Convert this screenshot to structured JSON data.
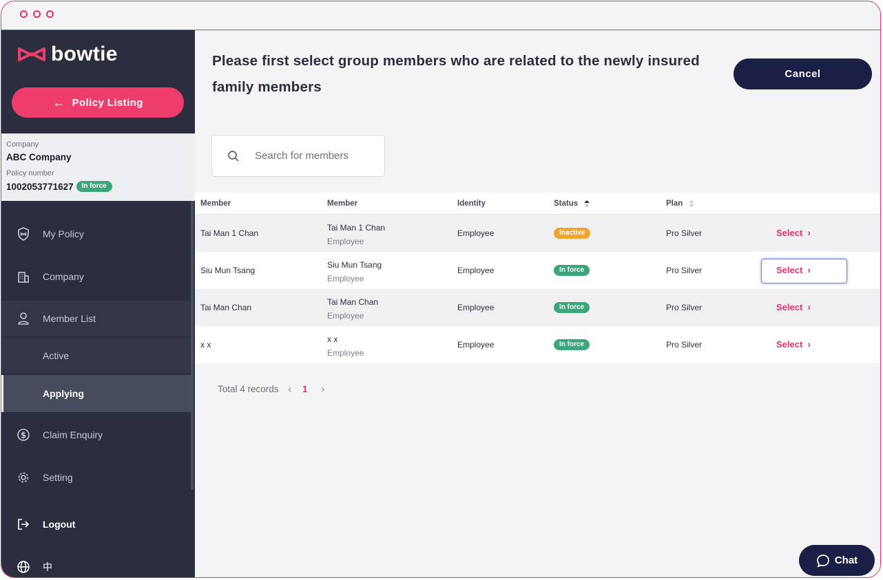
{
  "sidebar": {
    "logo": "bowtie",
    "policy_listing_label": "Policy Listing",
    "company_label": "Company",
    "company_value": "ABC Company",
    "policy_number_label": "Policy number",
    "policy_number_value": "1002053771627",
    "policy_status": "In force",
    "nav": {
      "my_policy": "My Policy",
      "company": "Company",
      "member_list": "Member List",
      "active": "Active",
      "applying": "Applying",
      "claim_enquiry": "Claim Enquiry",
      "setting": "Setting",
      "logout": "Logout",
      "language": "中"
    }
  },
  "main": {
    "heading": "Please first select group members who are related to the newly insured family members",
    "cancel_label": "Cancel",
    "search_placeholder": "Search for members",
    "columns": [
      "Member",
      "Member",
      "Identity",
      "Status",
      "Plan"
    ],
    "rows": [
      {
        "member": "Tai Man 1 Chan",
        "member_name": "Tai Man 1 Chan",
        "member_role": "Employee",
        "identity": "Employee",
        "status": "Inactive",
        "plan": "Pro Silver",
        "action": "Select"
      },
      {
        "member": "Siu Mun Tsang",
        "member_name": "Siu Mun Tsang",
        "member_role": "Employee",
        "identity": "Employee",
        "status": "In force",
        "plan": "Pro Silver",
        "action": "Select"
      },
      {
        "member": "Tai Man Chan",
        "member_name": "Tai Man Chan",
        "member_role": "Employee",
        "identity": "Employee",
        "status": "In force",
        "plan": "Pro Silver",
        "action": "Select"
      },
      {
        "member": "x x",
        "member_name": "x x",
        "member_role": "Employee",
        "identity": "Employee",
        "status": "In force",
        "plan": "Pro Silver",
        "action": "Select"
      }
    ],
    "pagination": {
      "total": "Total 4 records",
      "current_page": "1"
    },
    "chat_label": "Chat"
  },
  "colors": {
    "accent": "#e3306a",
    "navy": "#1b1f46",
    "sidebar": "#2b2e3e",
    "green": "#3aa67a",
    "orange": "#f0a431"
  }
}
